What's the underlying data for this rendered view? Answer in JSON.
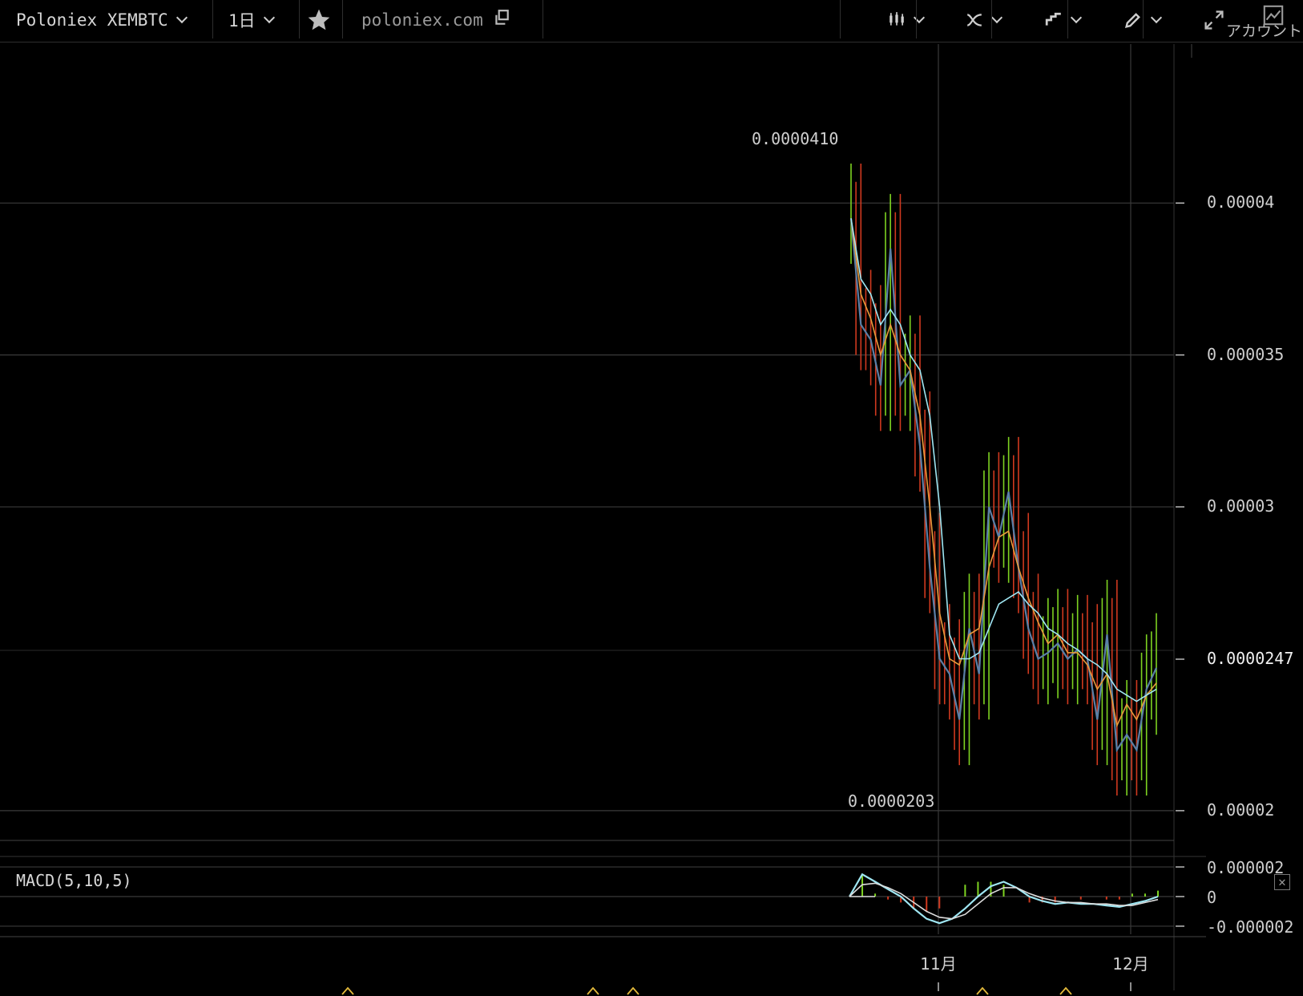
{
  "toolbar": {
    "symbol": "Poloniex XEMBTC",
    "interval": "1日",
    "source": "poloniex.com",
    "account_label": "アカウント"
  },
  "colors": {
    "background": "#000000",
    "grid": "#3a3a3a",
    "up": "#7ed321",
    "down": "#d0391f",
    "close_line": "#5a7fa6",
    "ma_short": "#e89a3c",
    "ma_long": "#9fe6f2"
  },
  "icons": [
    "star-icon",
    "external-link-icon",
    "candles-icon",
    "indicator-icon",
    "line-type-icon",
    "pencil-icon",
    "fullscreen-icon",
    "chart-icon",
    "close-icon"
  ],
  "chart_data": [
    {
      "type": "line",
      "title": "Poloniex XEMBTC 1日",
      "x_labels": [
        "11月",
        "12月"
      ],
      "y_ticks": [
        "0.00004",
        "0.000035",
        "0.00003",
        "0.00002"
      ],
      "last_price": "0.0000247",
      "high_label": "0.0000410",
      "low_label": "0.0000203",
      "ylim": [
        1.91e-05,
        4.51e-05
      ],
      "series": [
        {
          "values": [
            3.95e-05,
            3.6e-05,
            3.55e-05,
            3.4e-05,
            3.85e-05,
            3.4e-05,
            3.45e-05,
            3.2e-05,
            2.8e-05,
            2.5e-05,
            2.45e-05,
            2.3e-05,
            2.6e-05,
            2.45e-05,
            3e-05,
            2.9e-05,
            3.05e-05,
            2.8e-05,
            2.6e-05,
            2.5e-05,
            2.52e-05,
            2.55e-05,
            2.5e-05,
            2.53e-05,
            2.5e-05,
            2.3e-05,
            2.58e-05,
            2.2e-05,
            2.25e-05,
            2.2e-05,
            2.4e-05,
            2.47e-05
          ]
        },
        {
          "values": [
            3.95e-05,
            3.7e-05,
            3.62e-05,
            3.5e-05,
            3.6e-05,
            3.5e-05,
            3.45e-05,
            3.3e-05,
            3e-05,
            2.65e-05,
            2.5e-05,
            2.48e-05,
            2.58e-05,
            2.6e-05,
            2.8e-05,
            2.9e-05,
            2.92e-05,
            2.8e-05,
            2.7e-05,
            2.62e-05,
            2.55e-05,
            2.58e-05,
            2.52e-05,
            2.52e-05,
            2.48e-05,
            2.4e-05,
            2.45e-05,
            2.28e-05,
            2.35e-05,
            2.3e-05,
            2.38e-05,
            2.42e-05
          ]
        },
        {
          "values": [
            3.95e-05,
            3.75e-05,
            3.7e-05,
            3.6e-05,
            3.65e-05,
            3.6e-05,
            3.5e-05,
            3.45e-05,
            3.3e-05,
            3e-05,
            2.58e-05,
            2.5e-05,
            2.5e-05,
            2.52e-05,
            2.6e-05,
            2.68e-05,
            2.7e-05,
            2.72e-05,
            2.68e-05,
            2.65e-05,
            2.6e-05,
            2.58e-05,
            2.55e-05,
            2.53e-05,
            2.5e-05,
            2.48e-05,
            2.45e-05,
            2.4e-05,
            2.38e-05,
            2.36e-05,
            2.38e-05,
            2.4e-05
          ]
        }
      ]
    },
    {
      "type": "line",
      "title": "MACD(5,10,5)",
      "y_ticks": [
        "0.000002",
        "0",
        "-0.000002"
      ],
      "ylim": [
        -2.6e-06,
        2.6e-06
      ],
      "series": [
        {
          "values": [
            0,
            1.5e-06,
            1e-06,
            5e-07,
            0,
            -8e-07,
            -1.5e-06,
            -1.8e-06,
            -1.5e-06,
            -8e-07,
            0,
            7e-07,
            1e-06,
            6e-07,
            0,
            -3e-07,
            -5e-07,
            -4e-07,
            -5e-07,
            -5e-07,
            -6e-07,
            -7e-07,
            -5e-07,
            -3e-07,
            0
          ]
        },
        {
          "values": [
            0,
            8e-07,
            9e-07,
            6e-07,
            2e-07,
            -4e-07,
            -1e-06,
            -1.4e-06,
            -1.5e-06,
            -1.2e-06,
            -5e-07,
            2e-07,
            6e-07,
            6e-07,
            2e-07,
            -1e-07,
            -3e-07,
            -4e-07,
            -4e-07,
            -5e-07,
            -5e-07,
            -6e-07,
            -6e-07,
            -4e-07,
            -2e-07
          ]
        }
      ]
    }
  ]
}
